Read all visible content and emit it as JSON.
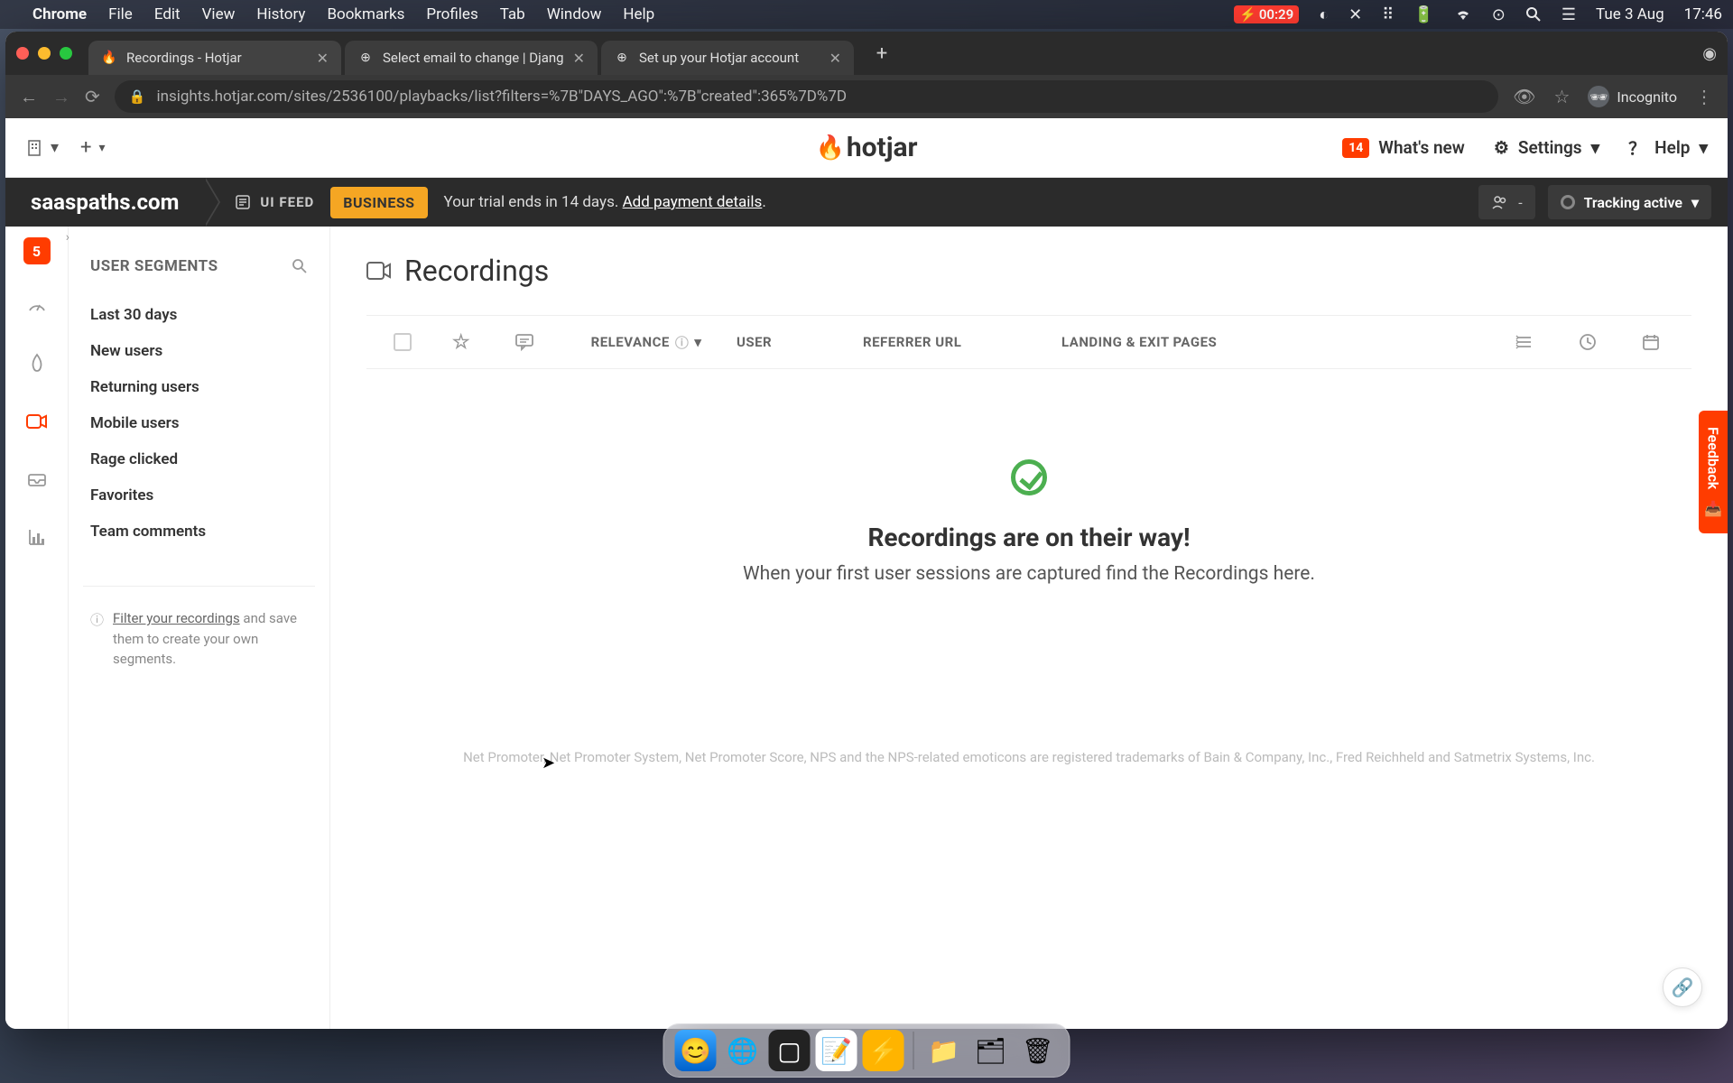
{
  "menubar": {
    "app": "Chrome",
    "items": [
      "File",
      "Edit",
      "View",
      "History",
      "Bookmarks",
      "Profiles",
      "Tab",
      "Window",
      "Help"
    ],
    "battery_time": "00:29",
    "date": "Tue 3 Aug",
    "clock": "17:46"
  },
  "browser": {
    "tabs": [
      {
        "title": "Recordings - Hotjar",
        "favicon": "🔥"
      },
      {
        "title": "Select email to change | Djang",
        "favicon": "⊕"
      },
      {
        "title": "Set up your Hotjar account",
        "favicon": "⊕"
      }
    ],
    "url": "insights.hotjar.com/sites/2536100/playbacks/list?filters=%7B\"DAYS_AGO\":%7B\"created\":365%7D%7D",
    "incognito": "Incognito"
  },
  "appbar": {
    "logo": "hotjar",
    "whatsnew_badge": "14",
    "whatsnew": "What's new",
    "settings": "Settings",
    "help": "Help"
  },
  "banner": {
    "site": "saaspaths.com",
    "uifeed": "UI FEED",
    "plan": "BUSINESS",
    "trial_text": "Your trial ends in 14 days.",
    "trial_link": "Add payment details",
    "trial_suffix": ".",
    "user_count": "-",
    "tracking": "Tracking active"
  },
  "rail": {
    "badge": "5"
  },
  "segments": {
    "title": "USER SEGMENTS",
    "items": [
      "Last 30 days",
      "New users",
      "Returning users",
      "Mobile users",
      "Rage clicked",
      "Favorites",
      "Team comments"
    ],
    "hint_link": "Filter your recordings",
    "hint_rest": " and save them to create your own segments."
  },
  "content": {
    "title": "Recordings",
    "columns": {
      "relevance": "RELEVANCE",
      "user": "USER",
      "referrer": "REFERRER URL",
      "landing": "LANDING & EXIT PAGES"
    },
    "empty_title": "Recordings are on their way!",
    "empty_sub": "When your first user sessions are captured find the Recordings here.",
    "footer": "Net Promoter, Net Promoter System, Net Promoter Score, NPS and the NPS-related emoticons are registered trademarks of Bain & Company, Inc., Fred Reichheld and Satmetrix Systems, Inc."
  },
  "feedback": "Feedback"
}
